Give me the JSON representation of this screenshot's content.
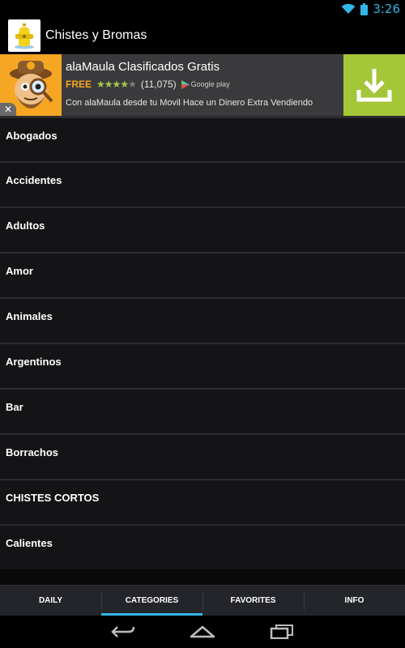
{
  "status": {
    "time": "3:26",
    "accent_color": "#33b5e5"
  },
  "app": {
    "title": "Chistes y Bromas",
    "icon": "fire-hydrant-icon"
  },
  "ad": {
    "title": "alaMaula Clasificados Gratis",
    "price": "FREE",
    "rating": 4,
    "rating_count": "(11,075)",
    "store": "Google play",
    "description": "Con alaMaula desde tu Movil Hace un Dinero Extra Vendiendo",
    "close_symbol": "✕",
    "download_color": "#a4c639"
  },
  "categories": [
    {
      "label": "Abogados"
    },
    {
      "label": "Accidentes"
    },
    {
      "label": "Adultos"
    },
    {
      "label": "Amor"
    },
    {
      "label": "Animales"
    },
    {
      "label": "Argentinos"
    },
    {
      "label": "Bar"
    },
    {
      "label": "Borrachos"
    },
    {
      "label": "CHISTES CORTOS"
    },
    {
      "label": "Calientes"
    }
  ],
  "tabs": [
    {
      "label": "DAILY",
      "active": false
    },
    {
      "label": "CATEGORIES",
      "active": true
    },
    {
      "label": "FAVORITES",
      "active": false
    },
    {
      "label": "INFO",
      "active": false
    }
  ]
}
